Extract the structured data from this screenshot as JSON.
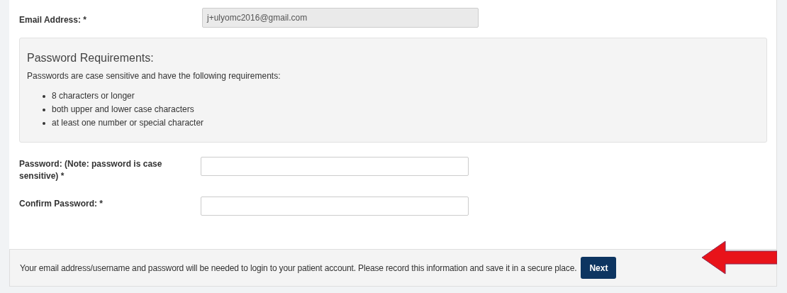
{
  "email": {
    "label": "Email Address: *",
    "value": "j+ulyomc2016@gmail.com",
    "disabled": true
  },
  "requirements": {
    "title": "Password Requirements:",
    "intro": "Passwords are case sensitive and have the following requirements:",
    "items": [
      "8 characters or longer",
      "both upper and lower case characters",
      "at least one number or special character"
    ]
  },
  "fields": [
    {
      "label": "Password: (Note: password is case sensitive) *"
    },
    {
      "label": "Confirm Password: *"
    }
  ],
  "footer": {
    "text": "Your email address/username and password will be needed to login to your patient account. Please record this information and save it in a secure place.",
    "button": "Next"
  }
}
